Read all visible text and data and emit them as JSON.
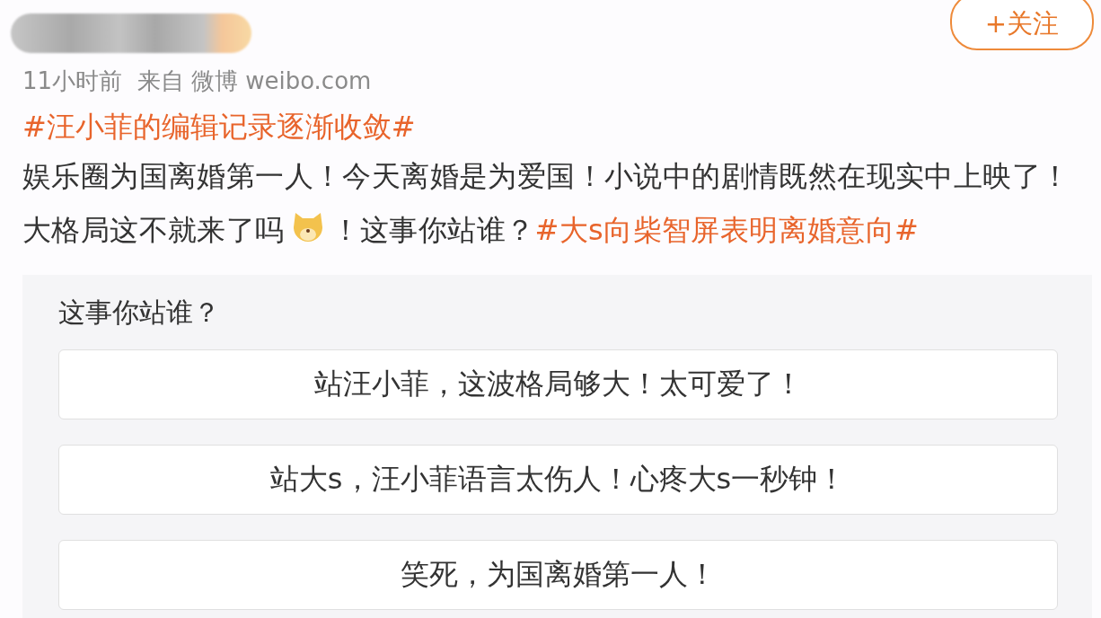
{
  "post": {
    "follow_button": "+关注",
    "meta": "11小时前  来自 微博 weibo.com",
    "topic": "#汪小菲的编辑记录逐渐收敛#",
    "body": [
      {
        "kind": "text",
        "text": "娱乐圈为国离婚第一人！今天离婚是为爱国！小说中的剧情既然在现实中上映了！大格局这不就来了吗"
      },
      {
        "kind": "emoji"
      },
      {
        "kind": "text",
        "text": "！这事你站谁？"
      },
      {
        "kind": "topic",
        "text": "#大s向柴智屏表明离婚意向#"
      }
    ]
  },
  "poll": {
    "question": "这事你站谁？",
    "options": [
      {
        "label": "站汪小菲，这波格局够大！太可爱了！"
      },
      {
        "label": "站大s，汪小菲语言太伤人！心疼大s一秒钟！"
      },
      {
        "label": "笑死，为国离婚第一人！"
      }
    ]
  }
}
